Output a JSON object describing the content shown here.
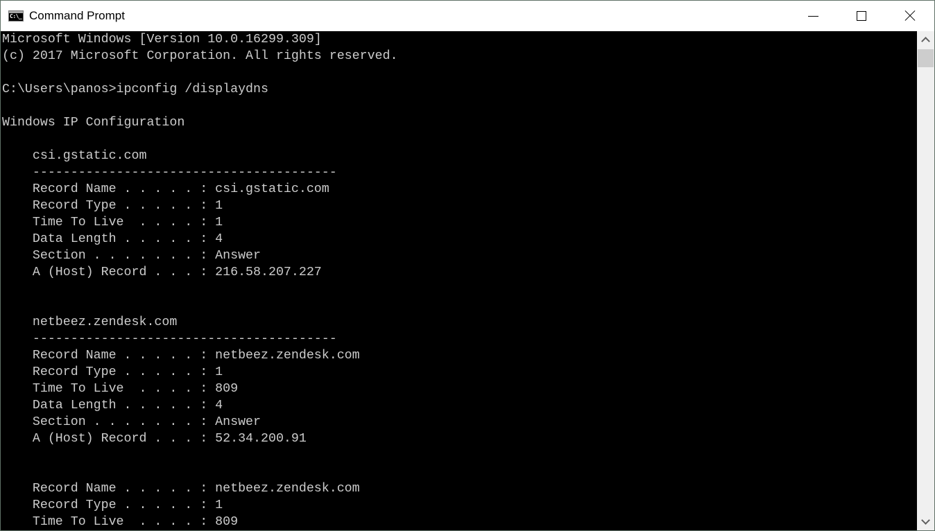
{
  "window": {
    "title": "Command Prompt",
    "app_icon": "cmd-icon",
    "app_icon_glyph": "C:\\_",
    "controls": {
      "minimize": "minimize-icon",
      "maximize": "maximize-icon",
      "close": "close-icon"
    }
  },
  "console": {
    "lines": [
      "Microsoft Windows [Version 10.0.16299.309]",
      "(c) 2017 Microsoft Corporation. All rights reserved.",
      "",
      "C:\\Users\\panos>ipconfig /displaydns",
      "",
      "Windows IP Configuration",
      "",
      "    csi.gstatic.com",
      "    ----------------------------------------",
      "    Record Name . . . . . : csi.gstatic.com",
      "    Record Type . . . . . : 1",
      "    Time To Live  . . . . : 1",
      "    Data Length . . . . . : 4",
      "    Section . . . . . . . : Answer",
      "    A (Host) Record . . . : 216.58.207.227",
      "",
      "",
      "    netbeez.zendesk.com",
      "    ----------------------------------------",
      "    Record Name . . . . . : netbeez.zendesk.com",
      "    Record Type . . . . . : 1",
      "    Time To Live  . . . . : 809",
      "    Data Length . . . . . : 4",
      "    Section . . . . . . . : Answer",
      "    A (Host) Record . . . : 52.34.200.91",
      "",
      "",
      "    Record Name . . . . . : netbeez.zendesk.com",
      "    Record Type . . . . . : 1",
      "    Time To Live  . . . . : 809"
    ]
  },
  "colors": {
    "console_bg": "#000000",
    "console_fg": "#cccccc",
    "titlebar_bg": "#ffffff",
    "scrollbar_bg": "#f0f0f0",
    "scrollbar_thumb": "#cdcdcd"
  }
}
